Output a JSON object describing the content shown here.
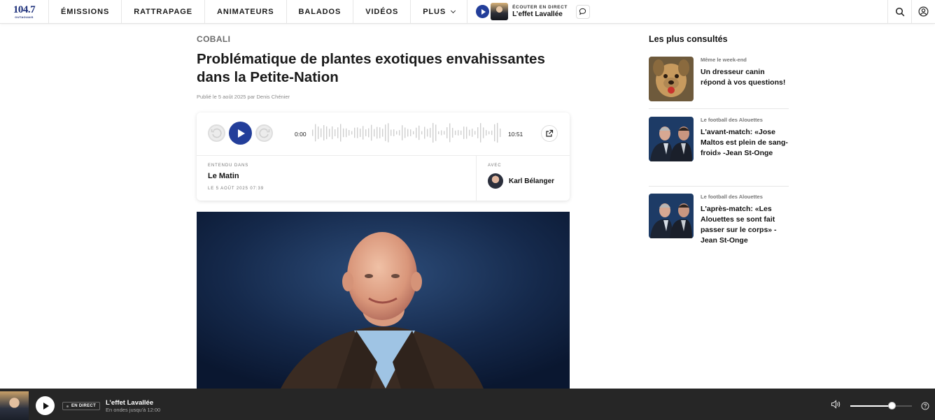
{
  "logo": {
    "number": "104.7",
    "city": "OUTAOUAIS"
  },
  "nav": {
    "items": [
      {
        "label": "ÉMISSIONS"
      },
      {
        "label": "RATTRAPAGE"
      },
      {
        "label": "ANIMATEURS"
      },
      {
        "label": "BALADOS"
      },
      {
        "label": "VIDÉOS"
      },
      {
        "label": "PLUS"
      }
    ],
    "live_kicker": "ÉCOUTER EN DIRECT",
    "live_show": "L’effet Lavallée"
  },
  "article": {
    "kicker": "COBALI",
    "title": "Problématique de plantes exotiques envahissantes dans la Petite-Nation",
    "byline": "Publié le 5 août 2025 par Denis Chénier"
  },
  "player": {
    "time_start": "0:00",
    "time_end": "10:51",
    "heard_in_label": "ENTENDU DANS",
    "show_name": "Le Matin",
    "show_date": "LE 5 AOÛT 2025 07:39",
    "with_label": "AVEC",
    "host_name": "Karl Bélanger"
  },
  "sidebar": {
    "title": "Les plus consultés",
    "items": [
      {
        "category": "Même le week-end",
        "headline": "Un dresseur canin répond à vos questions!"
      },
      {
        "category": "Le football des Alouettes",
        "headline": "L'avant-match: «Jose Maltos est plein de sang-froid» -Jean St-Onge"
      },
      {
        "category": "Le football des Alouettes",
        "headline": "L'après-match: «Les Alouettes se sont fait passer sur le corps» - Jean St-Onge"
      }
    ]
  },
  "bottom_player": {
    "live_badge": "EN DIRECT",
    "show": "L’effet Lavallée",
    "subtitle": "En ondes jusqu'à 12:00",
    "volume": 0.68
  },
  "colors": {
    "accent": "#233e9a",
    "bottom_bar": "#262626"
  }
}
